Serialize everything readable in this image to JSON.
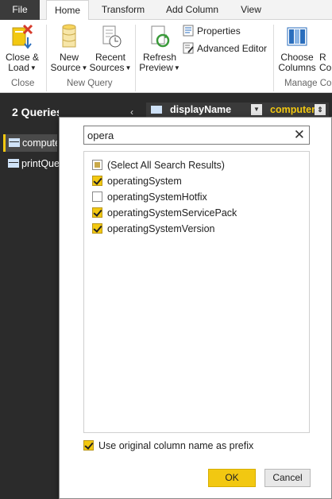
{
  "tabs": [
    {
      "label": "File"
    },
    {
      "label": "Home"
    },
    {
      "label": "Transform"
    },
    {
      "label": "Add Column"
    },
    {
      "label": "View"
    }
  ],
  "ribbon": {
    "close_load": {
      "line1": "Close &",
      "line2": "Load"
    },
    "new_source": {
      "line1": "New",
      "line2": "Source"
    },
    "recent_sources": {
      "line1": "Recent",
      "line2": "Sources"
    },
    "refresh_preview": {
      "line1": "Refresh",
      "line2": "Preview"
    },
    "properties": "Properties",
    "advanced_editor": "Advanced Editor",
    "choose_columns": {
      "line1": "Choose",
      "line2": "Columns"
    },
    "partial_next": {
      "line1": "R",
      "line2": "Co"
    },
    "groups": {
      "close": "Close",
      "new_query": "New Query",
      "manage_columns": "Manage Co"
    }
  },
  "queries": {
    "header": "2 Queries",
    "collapse_glyph": "‹",
    "items": [
      {
        "label": "compute"
      },
      {
        "label": "printQue"
      }
    ]
  },
  "grid": {
    "column_name": "displayName",
    "active_column": "computer",
    "dropdown_glyph": "▼",
    "expand_glyph": "⇕"
  },
  "dialog": {
    "search_value": "opera",
    "clear_glyph": "✕",
    "items": [
      {
        "label": "(Select All Search Results)",
        "state": "partial"
      },
      {
        "label": "operatingSystem",
        "state": "checked"
      },
      {
        "label": "operatingSystemHotfix",
        "state": "unchecked"
      },
      {
        "label": "operatingSystemServicePack",
        "state": "checked"
      },
      {
        "label": "operatingSystemVersion",
        "state": "checked"
      }
    ],
    "prefix_label": "Use original column name as prefix",
    "prefix_checked": true,
    "ok_label": "OK",
    "cancel_label": "Cancel"
  },
  "colors": {
    "accent": "#f2c811",
    "dark_panel": "#2b2b2b",
    "file_tab": "#3b3b3b"
  }
}
